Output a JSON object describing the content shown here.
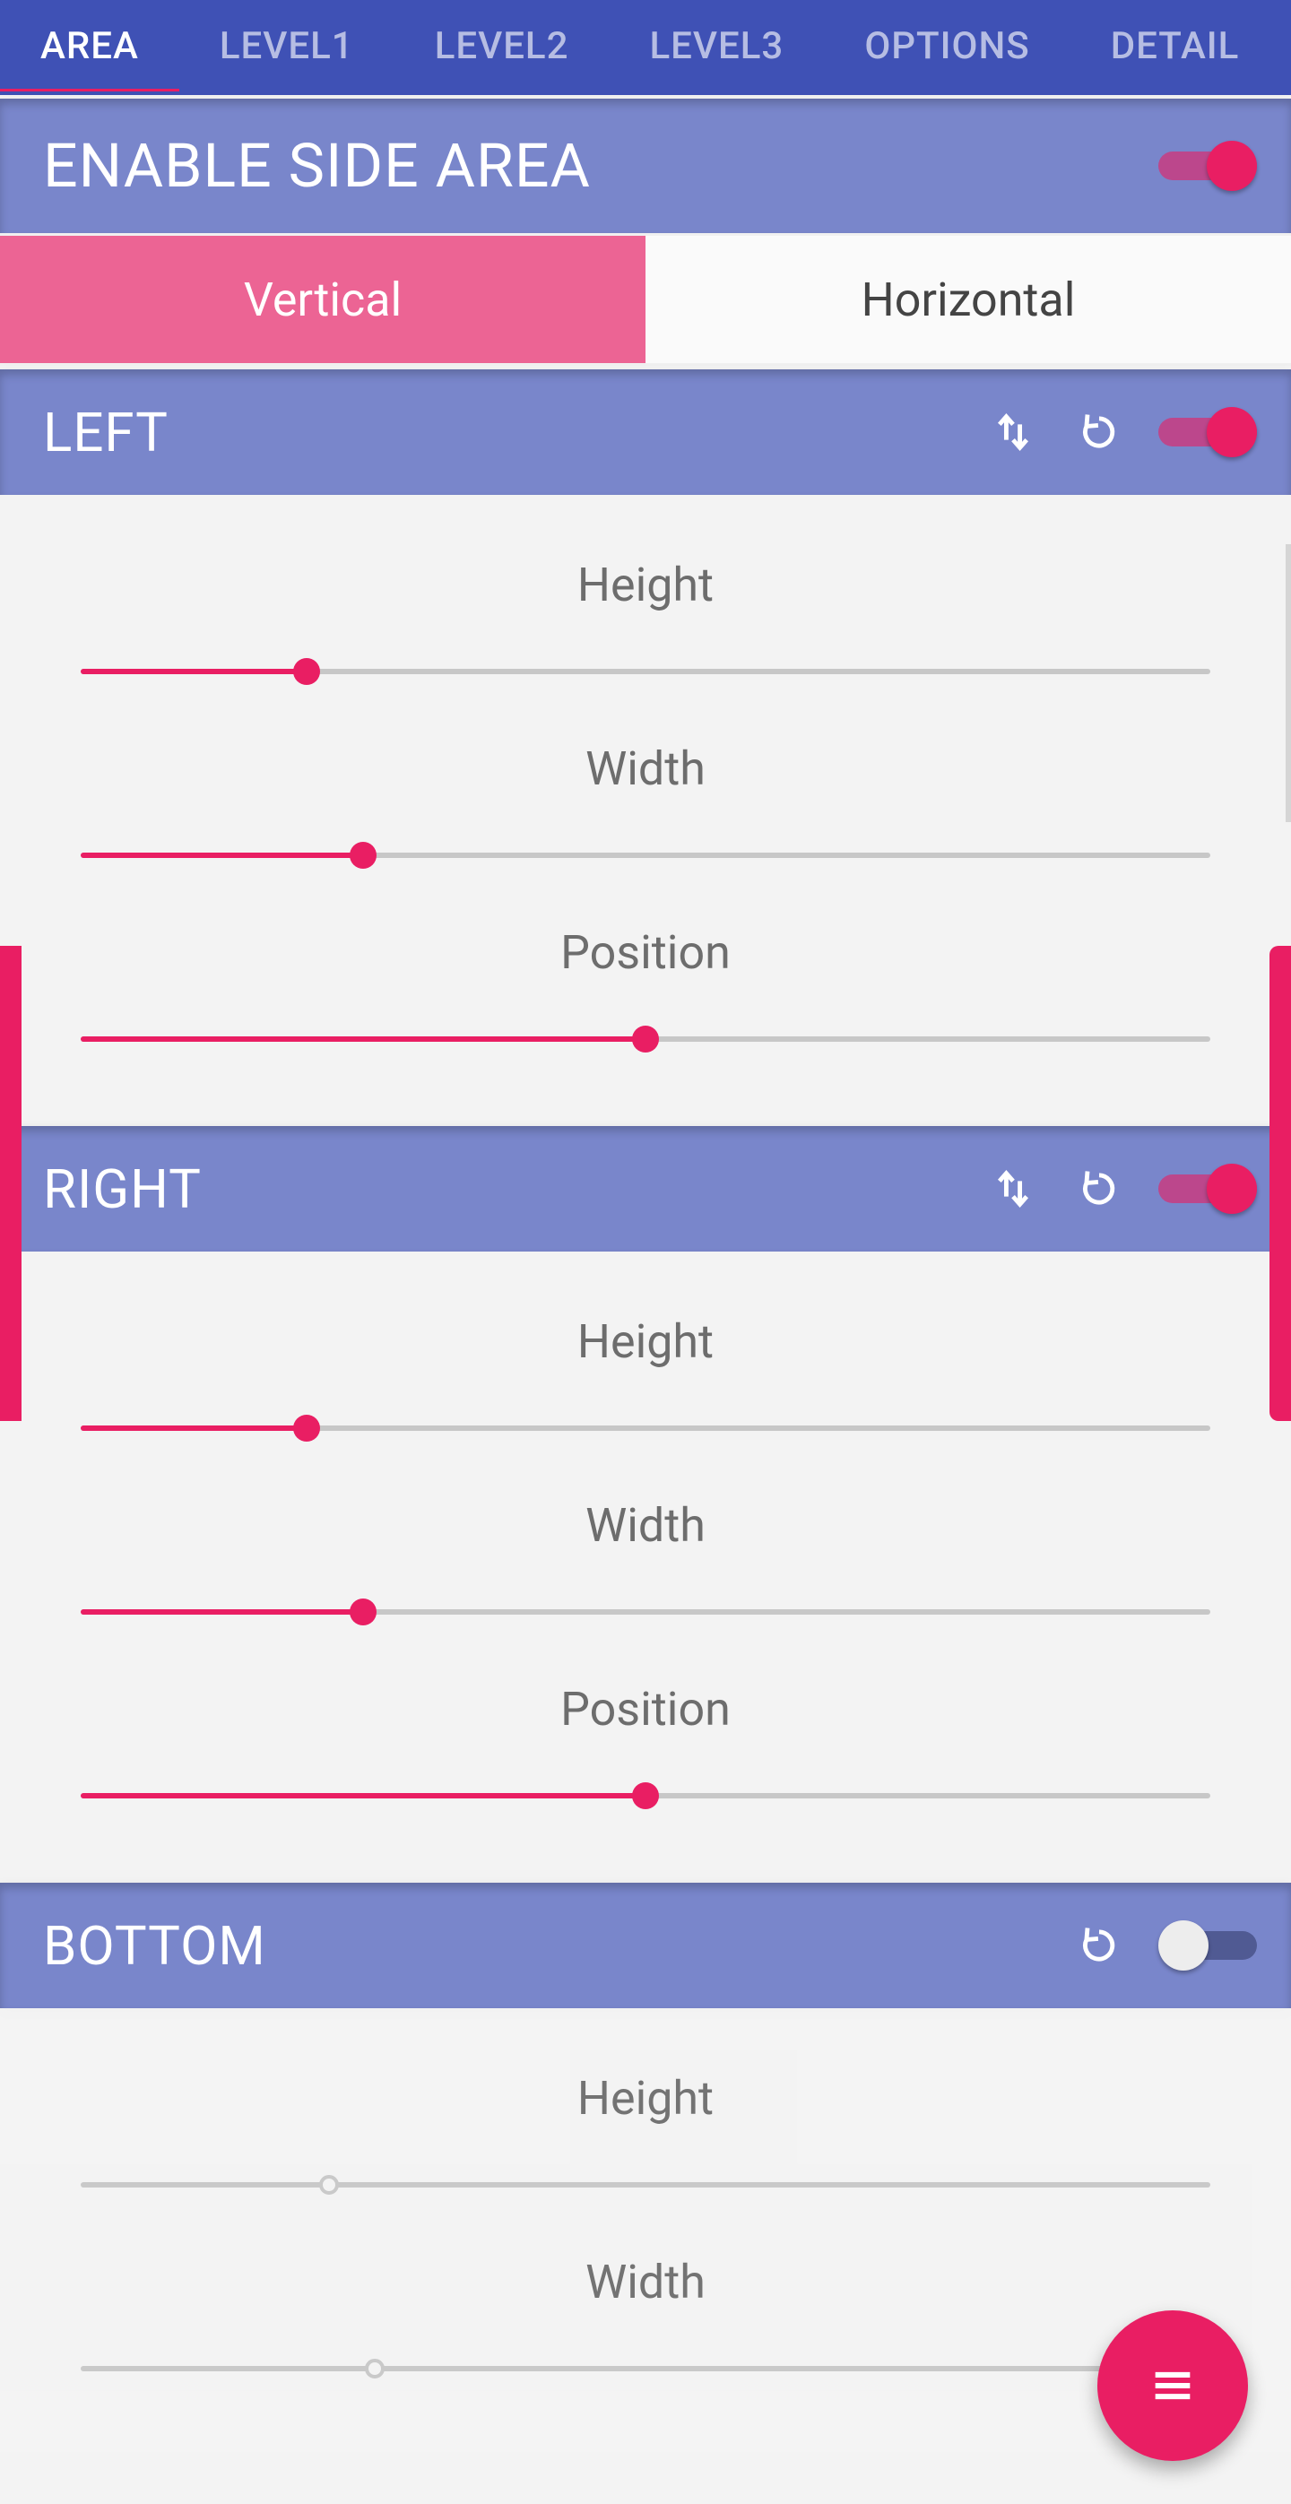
{
  "tabs": [
    "AREA",
    "LEVEL1",
    "LEVEL2",
    "LEVEL3",
    "OPTIONS",
    "DETAIL"
  ],
  "activeTab": 0,
  "enable": {
    "title": "ENABLE SIDE AREA",
    "on": true
  },
  "orientation": {
    "options": [
      "Vertical",
      "Horizontal"
    ],
    "active": 0
  },
  "sections": [
    {
      "id": "left",
      "title": "LEFT",
      "on": true,
      "hasSwap": true,
      "sliders": [
        {
          "label": "Height",
          "value": 20
        },
        {
          "label": "Width",
          "value": 25
        },
        {
          "label": "Position",
          "value": 50
        }
      ]
    },
    {
      "id": "right",
      "title": "RIGHT",
      "on": true,
      "hasSwap": true,
      "sliders": [
        {
          "label": "Height",
          "value": 20
        },
        {
          "label": "Width",
          "value": 25
        },
        {
          "label": "Position",
          "value": 50
        }
      ]
    },
    {
      "id": "bottom",
      "title": "BOTTOM",
      "on": false,
      "hasSwap": false,
      "sliders": [
        {
          "label": "Height",
          "value": 22
        },
        {
          "label": "Width",
          "value": 26
        }
      ]
    }
  ]
}
